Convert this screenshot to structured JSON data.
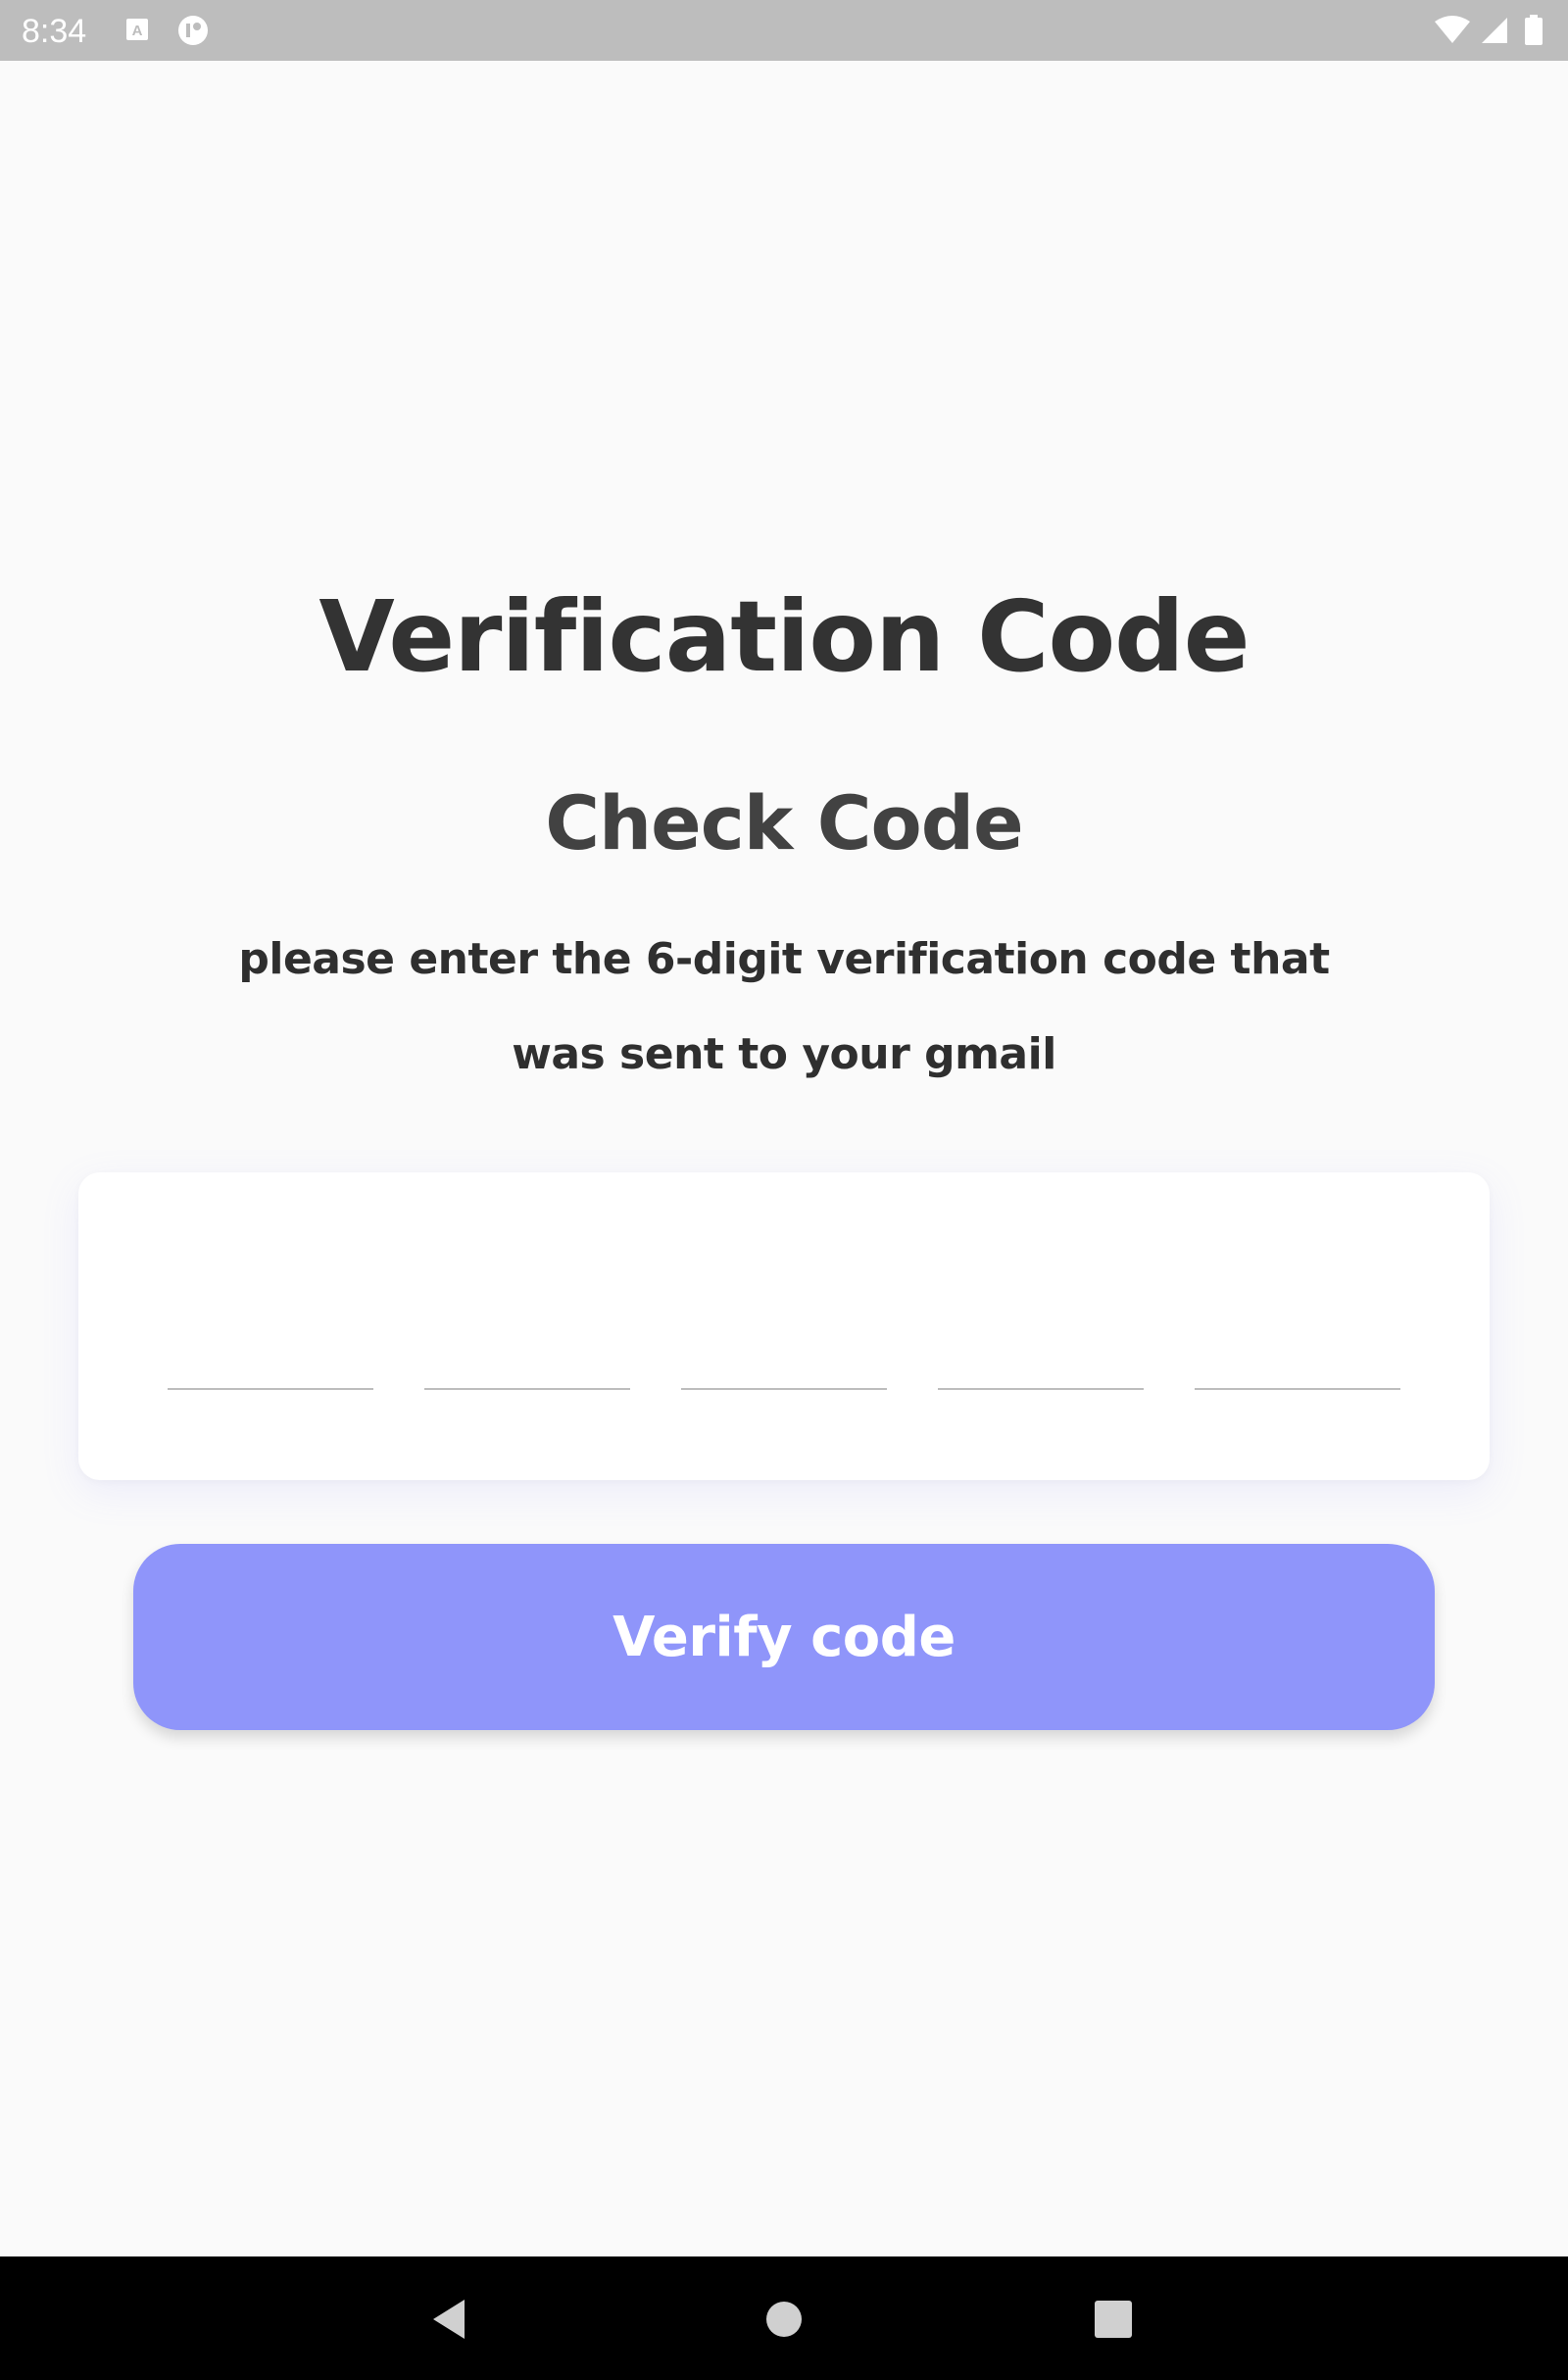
{
  "status_bar": {
    "time": "8:34",
    "icons": [
      "keyboard-a-icon",
      "app-notification-icon",
      "wifi-icon",
      "cell-signal-icon",
      "battery-icon"
    ]
  },
  "main": {
    "title": "Verification Code",
    "subtitle": "Check Code",
    "instructions": "please enter the 6-digit verification code that was sent to your gmail",
    "code_inputs": [
      "",
      "",
      "",
      "",
      ""
    ],
    "verify_button_label": "Verify code"
  },
  "navigation_bar": {
    "buttons": [
      "back-icon",
      "home-icon",
      "recents-icon"
    ]
  },
  "colors": {
    "accent": "#8f95fa",
    "background": "#fafafa",
    "status_bar": "#bdbdbd",
    "text": "#333333"
  }
}
